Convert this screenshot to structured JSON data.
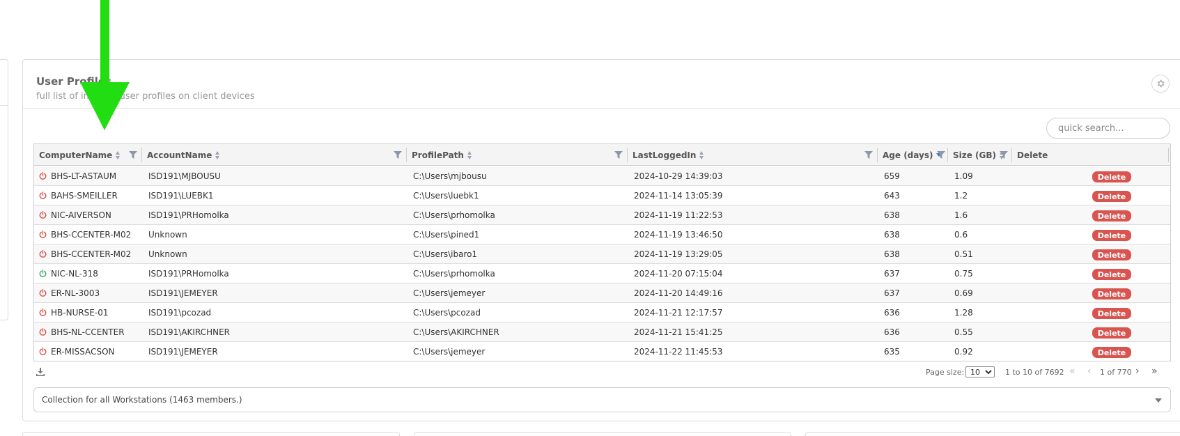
{
  "card": {
    "title": "User Profiles",
    "subtitle": "full list of indexed user profiles on client devices"
  },
  "search": {
    "placeholder": "quick search..."
  },
  "columns": {
    "computer": "ComputerName",
    "account": "AccountName",
    "profile": "ProfilePath",
    "lastlogged": "LastLoggedIn",
    "age": "Age (days)",
    "size": "Size (GB)",
    "delete": "Delete"
  },
  "rows": [
    {
      "online": false,
      "computer": "BHS-LT-ASTAUM",
      "account": "ISD191\\MJBOUSU",
      "profile": "C:\\Users\\mjbousu",
      "lastlogged": "2024-10-29 14:39:03",
      "age": "659",
      "size": "1.09"
    },
    {
      "online": false,
      "computer": "BAHS-SMEILLER",
      "account": "ISD191\\LUEBK1",
      "profile": "C:\\Users\\luebk1",
      "lastlogged": "2024-11-14 13:05:39",
      "age": "643",
      "size": "1.2"
    },
    {
      "online": false,
      "computer": "NIC-AIVERSON",
      "account": "ISD191\\PRHomolka",
      "profile": "C:\\Users\\prhomolka",
      "lastlogged": "2024-11-19 11:22:53",
      "age": "638",
      "size": "1.6"
    },
    {
      "online": false,
      "computer": "BHS-CCENTER-M02",
      "account": "Unknown",
      "profile": "C:\\Users\\pined1",
      "lastlogged": "2024-11-19 13:46:50",
      "age": "638",
      "size": "0.6"
    },
    {
      "online": false,
      "computer": "BHS-CCENTER-M02",
      "account": "Unknown",
      "profile": "C:\\Users\\ibaro1",
      "lastlogged": "2024-11-19 13:29:05",
      "age": "638",
      "size": "0.51"
    },
    {
      "online": true,
      "computer": "NIC-NL-318",
      "account": "ISD191\\PRHomolka",
      "profile": "C:\\Users\\prhomolka",
      "lastlogged": "2024-11-20 07:15:04",
      "age": "637",
      "size": "0.75"
    },
    {
      "online": false,
      "computer": "ER-NL-3003",
      "account": "ISD191\\JEMEYER",
      "profile": "C:\\Users\\jemeyer",
      "lastlogged": "2024-11-20 14:49:16",
      "age": "637",
      "size": "0.69"
    },
    {
      "online": false,
      "computer": "HB-NURSE-01",
      "account": "ISD191\\pcozad",
      "profile": "C:\\Users\\pcozad",
      "lastlogged": "2024-11-21 12:17:57",
      "age": "636",
      "size": "1.28"
    },
    {
      "online": false,
      "computer": "BHS-NL-CCENTER",
      "account": "ISD191\\AKIRCHNER",
      "profile": "C:\\Users\\AKIRCHNER",
      "lastlogged": "2024-11-21 15:41:25",
      "age": "636",
      "size": "0.55"
    },
    {
      "online": false,
      "computer": "ER-MISSACSON",
      "account": "ISD191\\JEMEYER",
      "profile": "C:\\Users\\jemeyer",
      "lastlogged": "2024-11-22 11:45:53",
      "age": "635",
      "size": "0.92"
    }
  ],
  "delete_label": "Delete",
  "pagination": {
    "page_size_label": "Page size:",
    "page_size": "10",
    "range": "1 to 10 of 7692",
    "page": "1 of 770"
  },
  "collection": {
    "label": "Collection for all Workstations (1463 members.)"
  },
  "colors": {
    "offline": "#d9534f",
    "online": "#3aa76d",
    "delete": "#d9534f",
    "arrow": "#22dd11"
  },
  "icons": {
    "gear": "gear-icon",
    "power": "power-icon",
    "filter": "filter-icon",
    "download": "download-icon"
  }
}
